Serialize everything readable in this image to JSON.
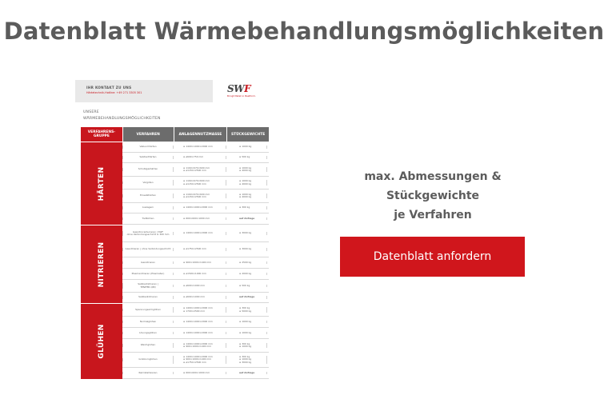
{
  "page": {
    "title": "Datenblatt Wärmebehandlungsmöglichkeiten",
    "caption_line1": "max. Abmessungen & Stückgewichte",
    "caption_line2": "je Verfahren",
    "cta_label": "Datenblatt anfordern",
    "accent_color": "#d0161c"
  },
  "datasheet": {
    "contact_line1": "IHR KONTAKT ZU UNS",
    "contact_line2": "Härtetechnik-Hotline: +49 271 3305 301",
    "logo_text": "SWF",
    "logo_tagline": "Bringt Metall in Bestform.",
    "heading_line1": "UNSERE",
    "heading_line2": "WÄRMEBEHANDLUNGSMÖGLICHKEITEN",
    "columns": {
      "group": "VERFAHRENS-GRUPPE",
      "process": "VERFAHREN",
      "dimensions": "ANLAGENNUTZMASSE",
      "weights": "STÜCKGEWICHTE"
    },
    "groups": [
      {
        "name": "HÄRTEN",
        "rows": [
          {
            "process": "Vakuumhärten",
            "dimensions": "≤ 1400×1000×2000 mm",
            "weight": "≤ 1000 Kg"
          },
          {
            "process": "Salzbadhärten",
            "dimensions": "≤ ø600×750 mm",
            "weight": "≤ 500 kg"
          },
          {
            "process": "Schutzgashärten",
            "dimensions": "≤ 1160×670×600 mm\n≤ ø1150×2500 mm",
            "weight": "≤ 1000 kg\n≤ 4000 kg"
          },
          {
            "process": "Vergüten",
            "dimensions": "≤ 1160×670×600 mm\n≤ ø1150×2500 mm",
            "weight": "≤ 1000 kg\n≤ 4000 kg"
          },
          {
            "process": "Einsatzhärten",
            "dimensions": "≤ 1160×670×600 mm\n≤ ø1150×2500 mm",
            "weight": "≤ 1000 kg\n≤ 4000 kg"
          },
          {
            "process": "Auslagern",
            "dimensions": "≤ 1400×1000×2000 mm",
            "weight": "≤ 300 kg"
          },
          {
            "process": "Tiefkühlen",
            "dimensions": "≤ 600×600×1000 mm",
            "weight": "auf Anfrage"
          }
        ]
      },
      {
        "name": "NITRIEREN",
        "rows": [
          {
            "process": "Gasnitrocarburieren | SWF\nohne Verbindungsschicht ≤ 300 mm",
            "dimensions": "≤ 1400×1000×2000 mm",
            "weight": "≤ 3000 kg"
          },
          {
            "process": "Gasnitrieren | ohne Verbindungsschicht",
            "dimensions": "≤ ø1750×2500 mm",
            "weight": "≤ 3000 kg"
          },
          {
            "process": "Gasnitrieren",
            "dimensions": "≤ 900×1000×1400 mm",
            "weight": "≤ 2500 kg"
          },
          {
            "process": "Plasmanitrieren (Plasmatec)",
            "dimensions": "≤ ø1500×1000 mm",
            "weight": "≤ 2000 kg"
          },
          {
            "process": "Salzbadnitrieren |\nTENIFER QPQ",
            "dimensions": "≤ ø600×1000 mm",
            "weight": "≤ 500 kg"
          },
          {
            "process": "Salzbadnitrieren",
            "dimensions": "≤ ø600×1000 mm",
            "weight": "auf Anfrage"
          }
        ]
      },
      {
        "name": "GLÜHEN",
        "rows": [
          {
            "process": "Spannungsarmglühen",
            "dimensions": "≤ 1400×1000×2000 mm\n≤ 1700×2500 mm",
            "weight": "≤ 300 kg\n≤ 5000 kg"
          },
          {
            "process": "Normalglühen",
            "dimensions": "≤ 1400×1000×2000 mm",
            "weight": "≤ 1000 kg"
          },
          {
            "process": "Lösungsglühen",
            "dimensions": "≤ 1400×1000×2000 mm",
            "weight": "≤ 1000 kg"
          },
          {
            "process": "Weichglühen",
            "dimensions": "≤ 1400×1000×2000 mm\n≤ 900×1000×1400 mm",
            "weight": "≤ 300 kg\n≤ 1000 kg"
          },
          {
            "process": "Grobkornglühen",
            "dimensions": "≤ 1400×1000×2000 mm\n≤ 900×1000×1400 mm\n≤ ø1750×2500 mm",
            "weight": "≤ 300 kg\n≤ 1000 kg\n≤ 3000 kg"
          },
          {
            "process": "Rekristallisieren",
            "dimensions": "≤ 600×600×1000 mm",
            "weight": "auf Anfrage"
          }
        ]
      }
    ]
  }
}
